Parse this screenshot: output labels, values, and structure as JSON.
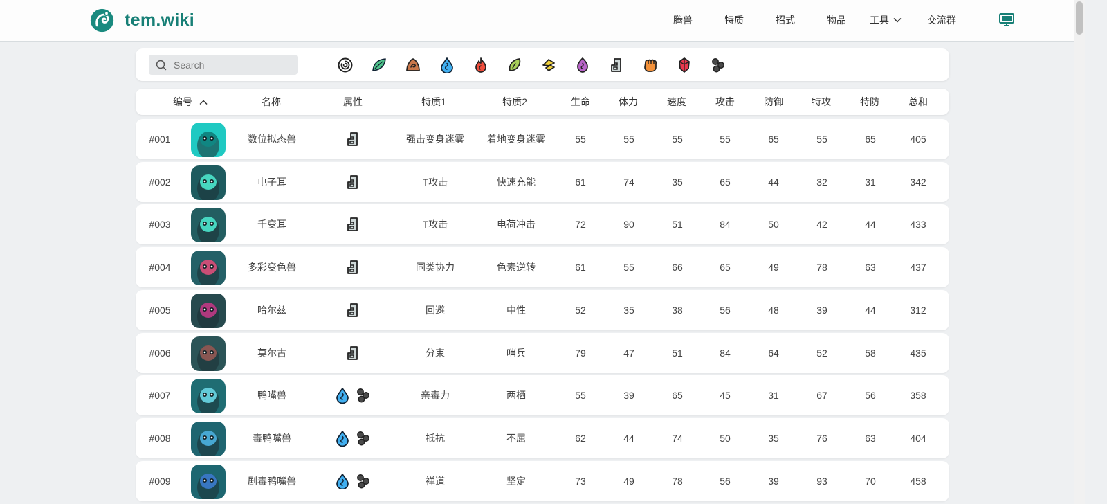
{
  "header": {
    "logo_text": "tem.wiki",
    "nav": [
      "腾兽",
      "特质",
      "招式",
      "物品",
      "工具",
      "交流群"
    ],
    "brand_color": "#177f76"
  },
  "search": {
    "placeholder": "Search",
    "value": ""
  },
  "type_filters": [
    "neutral",
    "wind",
    "earth",
    "water",
    "fire",
    "nature",
    "electric",
    "mental",
    "digital",
    "melee",
    "crystal",
    "toxic"
  ],
  "table": {
    "headers": [
      "编号",
      "名称",
      "属性",
      "特质1",
      "特质2",
      "生命",
      "体力",
      "速度",
      "攻击",
      "防御",
      "特攻",
      "特防",
      "总和"
    ],
    "sort": {
      "column": "编号",
      "direction": "ascending"
    },
    "rows": [
      {
        "id": "#001",
        "name": "数位拟态兽",
        "types": [
          "digital"
        ],
        "trait1": "强击变身迷雾",
        "trait2": "着地变身迷雾",
        "hp": "55",
        "sta": "55",
        "spd": "55",
        "atk": "55",
        "def": "65",
        "spatk": "55",
        "spdef": "65",
        "total": "405",
        "avatar": {
          "bg": "#1fc9c2",
          "accent": "#0e8a85"
        }
      },
      {
        "id": "#002",
        "name": "电子耳",
        "types": [
          "digital"
        ],
        "trait1": "T攻击",
        "trait2": "快速充能",
        "hp": "61",
        "sta": "74",
        "spd": "35",
        "atk": "65",
        "def": "44",
        "spatk": "32",
        "spdef": "31",
        "total": "342",
        "avatar": {
          "bg": "#1e5b5f",
          "accent": "#4ff0d6"
        }
      },
      {
        "id": "#003",
        "name": "千变耳",
        "types": [
          "digital"
        ],
        "trait1": "T攻击",
        "trait2": "电荷冲击",
        "hp": "72",
        "sta": "90",
        "spd": "51",
        "atk": "84",
        "def": "50",
        "spatk": "42",
        "spdef": "44",
        "total": "433",
        "avatar": {
          "bg": "#235e61",
          "accent": "#4ff0d6"
        }
      },
      {
        "id": "#004",
        "name": "多彩变色兽",
        "types": [
          "digital"
        ],
        "trait1": "同类协力",
        "trait2": "色素逆转",
        "hp": "61",
        "sta": "55",
        "spd": "66",
        "atk": "65",
        "def": "49",
        "spatk": "78",
        "spdef": "63",
        "total": "437",
        "avatar": {
          "bg": "#246067",
          "accent": "#e8507e"
        }
      },
      {
        "id": "#005",
        "name": "哈尔兹",
        "types": [
          "digital"
        ],
        "trait1": "回避",
        "trait2": "中性",
        "hp": "52",
        "sta": "35",
        "spd": "38",
        "atk": "56",
        "def": "48",
        "spatk": "39",
        "spdef": "44",
        "total": "312",
        "avatar": {
          "bg": "#274a4e",
          "accent": "#c93a8a"
        }
      },
      {
        "id": "#006",
        "name": "莫尔古",
        "types": [
          "digital"
        ],
        "trait1": "分束",
        "trait2": "哨兵",
        "hp": "79",
        "sta": "47",
        "spd": "51",
        "atk": "84",
        "def": "64",
        "spatk": "52",
        "spdef": "58",
        "total": "435",
        "avatar": {
          "bg": "#2b5457",
          "accent": "#9a5a55"
        }
      },
      {
        "id": "#007",
        "name": "鸭嘴兽",
        "types": [
          "water",
          "toxic"
        ],
        "trait1": "亲毒力",
        "trait2": "两栖",
        "hp": "55",
        "sta": "39",
        "spd": "65",
        "atk": "45",
        "def": "31",
        "spatk": "67",
        "spdef": "56",
        "total": "358",
        "avatar": {
          "bg": "#1f6d73",
          "accent": "#6ee0f0"
        }
      },
      {
        "id": "#008",
        "name": "毒鸭嘴兽",
        "types": [
          "water",
          "toxic"
        ],
        "trait1": "抵抗",
        "trait2": "不屈",
        "hp": "62",
        "sta": "44",
        "spd": "74",
        "atk": "50",
        "def": "35",
        "spatk": "76",
        "spdef": "63",
        "total": "404",
        "avatar": {
          "bg": "#1f6570",
          "accent": "#4fb9ea"
        }
      },
      {
        "id": "#009",
        "name": "剧毒鸭嘴兽",
        "types": [
          "water",
          "toxic"
        ],
        "trait1": "禅道",
        "trait2": "坚定",
        "hp": "73",
        "sta": "49",
        "spd": "78",
        "atk": "56",
        "def": "39",
        "spatk": "93",
        "spdef": "70",
        "total": "458",
        "avatar": {
          "bg": "#1d6670",
          "accent": "#3d7fd6"
        }
      }
    ]
  }
}
